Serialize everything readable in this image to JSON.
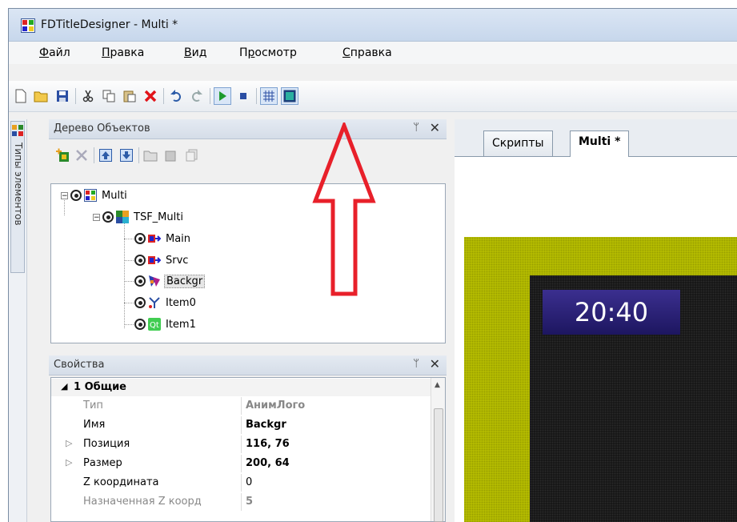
{
  "window": {
    "title": "FDTitleDesigner - Multi *"
  },
  "menu": [
    {
      "accel": "Ф",
      "rest": "айл"
    },
    {
      "accel": "П",
      "rest": "равка"
    },
    {
      "accel": "В",
      "rest": "ид"
    },
    {
      "accel": "",
      "pre": "П",
      "accel2": "р",
      "rest": "осмотр"
    },
    {
      "accel": "С",
      "rest": "правка"
    }
  ],
  "side_tab": {
    "label": "Типы элементов"
  },
  "tree_panel": {
    "title": "Дерево Объектов",
    "pin": "ᛘ",
    "close": "✕",
    "nodes": [
      "Multi",
      "TSF_Multi",
      "Main",
      "Srvc",
      "Backgr",
      "Item0",
      "Item1"
    ],
    "selected": "Backgr"
  },
  "props_panel": {
    "title": "Свойства",
    "pin": "ᛘ",
    "close": "✕",
    "group": "1 Общие",
    "rows": [
      {
        "key": "Тип",
        "value": "АнимЛого",
        "disabled": true,
        "bold": true,
        "expand": ""
      },
      {
        "key": "Имя",
        "value": "Backgr",
        "disabled": false,
        "bold": true,
        "expand": ""
      },
      {
        "key": "Позиция",
        "value": "116, 76",
        "disabled": false,
        "bold": true,
        "expand": "▷"
      },
      {
        "key": "Размер",
        "value": "200, 64",
        "disabled": false,
        "bold": true,
        "expand": "▷"
      },
      {
        "key": "Z координата",
        "value": "0",
        "disabled": false,
        "bold": false,
        "expand": ""
      },
      {
        "key": "Назначенная Z коорд",
        "value": "5",
        "disabled": true,
        "bold": true,
        "expand": ""
      }
    ]
  },
  "doc_tabs": [
    {
      "label": "Скрипты",
      "active": false
    },
    {
      "label": "Multi *",
      "active": true
    }
  ],
  "preview": {
    "clock_text": "20:40"
  },
  "colors": {
    "accent": "#e8202a",
    "canvas_yellow": "#b8bf00",
    "clock_bg": "#2b2178"
  }
}
